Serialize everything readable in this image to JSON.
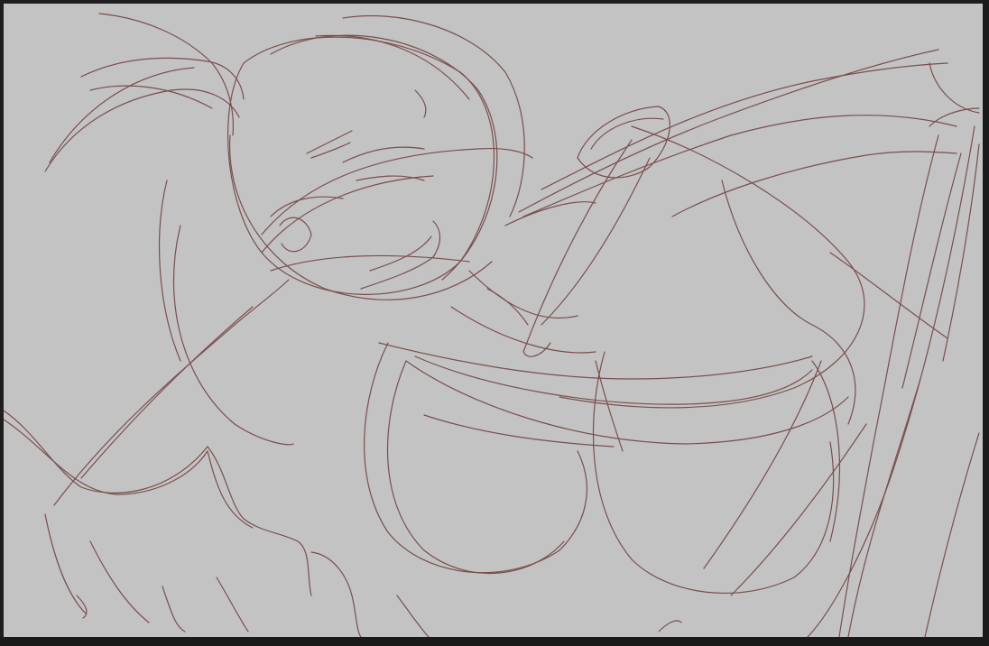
{
  "canvas": {
    "background_color": "#c3c3c3",
    "stroke_color": "#6e3a3a",
    "frame_color": "#1e1e1e",
    "content": "pencil-sketch"
  }
}
